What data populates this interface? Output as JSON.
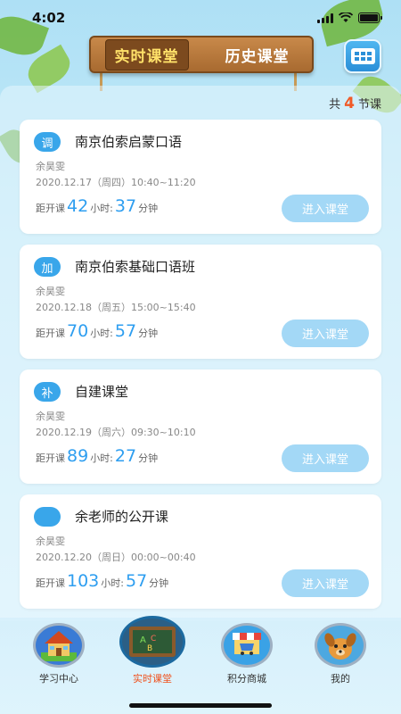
{
  "status_bar": {
    "time": "4:02"
  },
  "header": {
    "tabs": [
      {
        "label": "实时课堂",
        "active": true
      },
      {
        "label": "历史课堂",
        "active": false
      }
    ],
    "calendar_icon": "calendar-icon"
  },
  "summary": {
    "prefix": "共",
    "count": "4",
    "suffix": "节课"
  },
  "countdown_prefix": "距开课",
  "hour_unit": "小时:",
  "minute_unit": "分钟",
  "courses": [
    {
      "badge": "调",
      "title": "南京伯索启蒙口语",
      "teacher": "余昊雯",
      "time": "2020.12.17（周四）10:40~11:20",
      "hours": "42",
      "minutes": "37",
      "button": "进入课堂"
    },
    {
      "badge": "加",
      "title": "南京伯索基础口语班",
      "teacher": "余昊雯",
      "time": "2020.12.18（周五）15:00~15:40",
      "hours": "70",
      "minutes": "57",
      "button": "进入课堂"
    },
    {
      "badge": "补",
      "title": "自建课堂",
      "teacher": "余昊雯",
      "time": "2020.12.19（周六）09:30~10:10",
      "hours": "89",
      "minutes": "27",
      "button": "进入课堂"
    },
    {
      "badge": "",
      "title": "余老师的公开课",
      "teacher": "余昊雯",
      "time": "2020.12.20（周日）00:00~00:40",
      "hours": "103",
      "minutes": "57",
      "button": "进入课堂"
    }
  ],
  "tabbar": [
    {
      "label": "学习中心",
      "icon": "school-house-icon",
      "active": false
    },
    {
      "label": "实时课堂",
      "icon": "blackboard-icon",
      "active": true
    },
    {
      "label": "积分商城",
      "icon": "shop-cart-icon",
      "active": false
    },
    {
      "label": "我的",
      "icon": "dog-avatar-icon",
      "active": false
    }
  ],
  "colors": {
    "accent": "#2e9ef0",
    "active_tab": "#f0501c",
    "count": "#f05a28"
  }
}
